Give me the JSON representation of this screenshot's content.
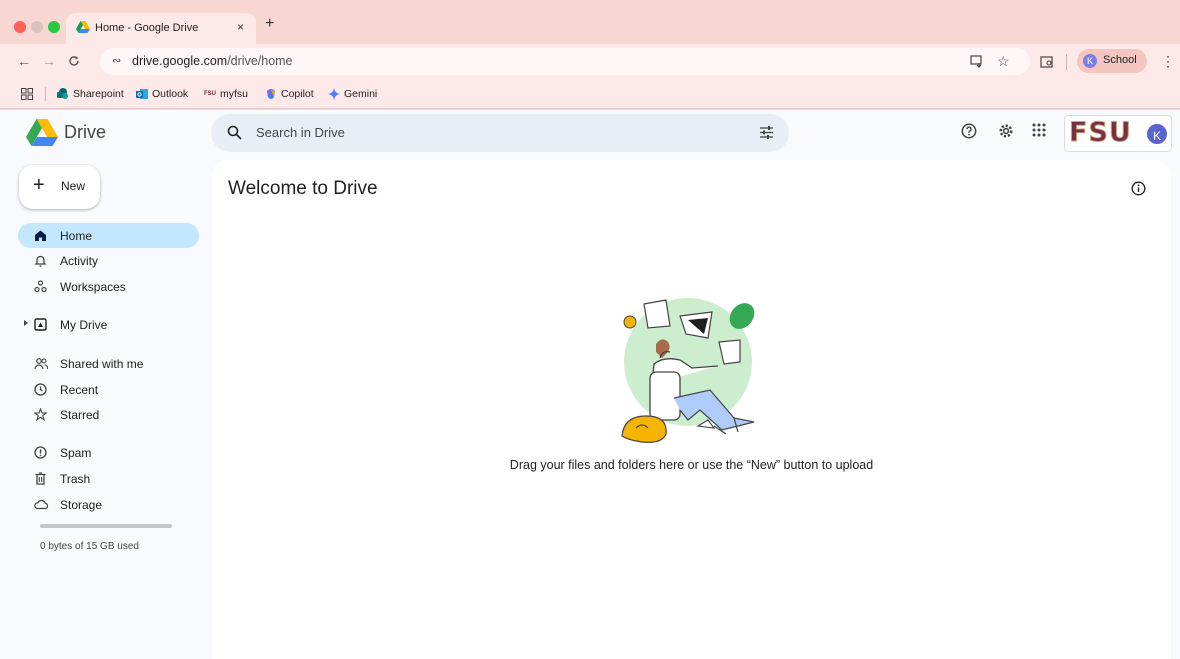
{
  "browser": {
    "tab": {
      "title": "Home - Google Drive",
      "close": "×",
      "new_tab": "+"
    },
    "url": {
      "domain": "drive.google.com",
      "path": "/drive/home"
    },
    "profile": {
      "initial": "K",
      "label": "School"
    },
    "colors": {
      "frame": "#f8d7d3",
      "toolbar": "#fde9e7"
    },
    "bookmarks": [
      {
        "label": "Sharepoint",
        "icon": "sharepoint-icon"
      },
      {
        "label": "Outlook",
        "icon": "outlook-icon"
      },
      {
        "label": "myfsu",
        "icon": "fsu-icon"
      },
      {
        "label": "Copilot",
        "icon": "copilot-icon"
      },
      {
        "label": "Gemini",
        "icon": "gemini-icon"
      }
    ]
  },
  "drive": {
    "title": "Drive",
    "search": {
      "placeholder": "Search in Drive"
    },
    "org_logo_text": "FSU",
    "avatar_initial": "K",
    "new_button": "New",
    "nav": [
      {
        "label": "Home",
        "icon": "home-icon",
        "active": true
      },
      {
        "label": "Activity",
        "icon": "bell-icon"
      },
      {
        "label": "Workspaces",
        "icon": "workspaces-icon"
      },
      {
        "label": "My Drive",
        "icon": "my-drive-icon"
      },
      {
        "label": "Shared with me",
        "icon": "people-icon"
      },
      {
        "label": "Recent",
        "icon": "clock-icon"
      },
      {
        "label": "Starred",
        "icon": "star-icon"
      },
      {
        "label": "Spam",
        "icon": "spam-icon"
      },
      {
        "label": "Trash",
        "icon": "trash-icon"
      },
      {
        "label": "Storage",
        "icon": "cloud-icon"
      }
    ],
    "storage": {
      "text": "0 bytes of 15 GB used",
      "used_fraction": 0
    },
    "main": {
      "heading": "Welcome to Drive",
      "empty_message": "Drag your files and folders here or use the “New” button to upload"
    }
  }
}
